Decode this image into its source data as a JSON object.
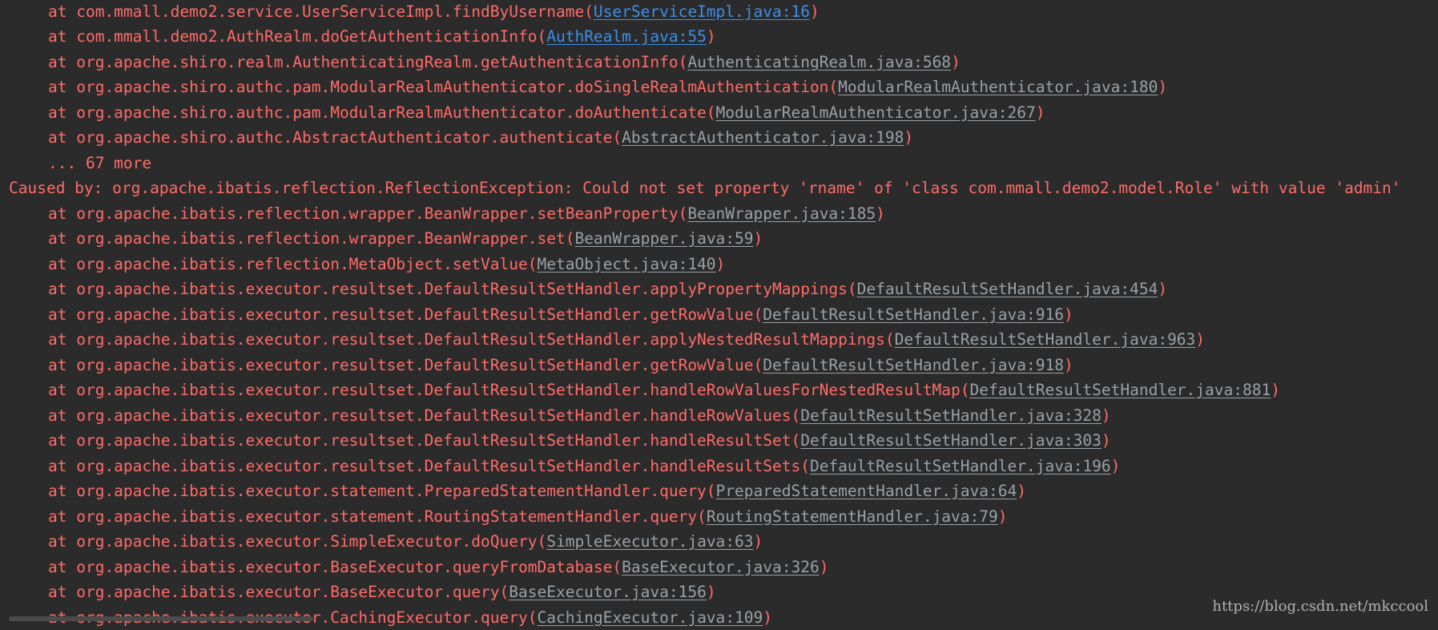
{
  "console": {
    "colors": {
      "background": "#2b2b2b",
      "error_text": "#ff6b68",
      "link_gray": "#9aa0a6",
      "link_blue": "#3d8ee8"
    },
    "lines": [
      {
        "kind": "frame",
        "prefix": "at com.mmall.demo2.service.UserServiceImpl.findByUsername(",
        "link": "UserServiceImpl.java:16",
        "suffix": ")",
        "link_style": "blue"
      },
      {
        "kind": "frame",
        "prefix": "at com.mmall.demo2.AuthRealm.doGetAuthenticationInfo(",
        "link": "AuthRealm.java:55",
        "suffix": ")",
        "link_style": "blue"
      },
      {
        "kind": "frame",
        "prefix": "at org.apache.shiro.realm.AuthenticatingRealm.getAuthenticationInfo(",
        "link": "AuthenticatingRealm.java:568",
        "suffix": ")",
        "link_style": "gray"
      },
      {
        "kind": "frame",
        "prefix": "at org.apache.shiro.authc.pam.ModularRealmAuthenticator.doSingleRealmAuthentication(",
        "link": "ModularRealmAuthenticator.java:180",
        "suffix": ")",
        "link_style": "gray"
      },
      {
        "kind": "frame",
        "prefix": "at org.apache.shiro.authc.pam.ModularRealmAuthenticator.doAuthenticate(",
        "link": "ModularRealmAuthenticator.java:267",
        "suffix": ")",
        "link_style": "gray"
      },
      {
        "kind": "frame",
        "prefix": "at org.apache.shiro.authc.AbstractAuthenticator.authenticate(",
        "link": "AbstractAuthenticator.java:198",
        "suffix": ")",
        "link_style": "gray"
      },
      {
        "kind": "more",
        "prefix": "... 67 more",
        "link": "",
        "suffix": "",
        "link_style": "none"
      },
      {
        "kind": "caused",
        "prefix": "Caused by: org.apache.ibatis.reflection.ReflectionException: Could not set property 'rname' of 'class com.mmall.demo2.model.Role' with value 'admin'",
        "link": "",
        "suffix": "",
        "link_style": "none"
      },
      {
        "kind": "frame",
        "prefix": "at org.apache.ibatis.reflection.wrapper.BeanWrapper.setBeanProperty(",
        "link": "BeanWrapper.java:185",
        "suffix": ")",
        "link_style": "gray"
      },
      {
        "kind": "frame",
        "prefix": "at org.apache.ibatis.reflection.wrapper.BeanWrapper.set(",
        "link": "BeanWrapper.java:59",
        "suffix": ")",
        "link_style": "gray"
      },
      {
        "kind": "frame",
        "prefix": "at org.apache.ibatis.reflection.MetaObject.setValue(",
        "link": "MetaObject.java:140",
        "suffix": ")",
        "link_style": "gray"
      },
      {
        "kind": "frame",
        "prefix": "at org.apache.ibatis.executor.resultset.DefaultResultSetHandler.applyPropertyMappings(",
        "link": "DefaultResultSetHandler.java:454",
        "suffix": ")",
        "link_style": "gray"
      },
      {
        "kind": "frame",
        "prefix": "at org.apache.ibatis.executor.resultset.DefaultResultSetHandler.getRowValue(",
        "link": "DefaultResultSetHandler.java:916",
        "suffix": ")",
        "link_style": "gray"
      },
      {
        "kind": "frame",
        "prefix": "at org.apache.ibatis.executor.resultset.DefaultResultSetHandler.applyNestedResultMappings(",
        "link": "DefaultResultSetHandler.java:963",
        "suffix": ")",
        "link_style": "gray"
      },
      {
        "kind": "frame",
        "prefix": "at org.apache.ibatis.executor.resultset.DefaultResultSetHandler.getRowValue(",
        "link": "DefaultResultSetHandler.java:918",
        "suffix": ")",
        "link_style": "gray"
      },
      {
        "kind": "frame",
        "prefix": "at org.apache.ibatis.executor.resultset.DefaultResultSetHandler.handleRowValuesForNestedResultMap(",
        "link": "DefaultResultSetHandler.java:881",
        "suffix": ")",
        "link_style": "gray"
      },
      {
        "kind": "frame",
        "prefix": "at org.apache.ibatis.executor.resultset.DefaultResultSetHandler.handleRowValues(",
        "link": "DefaultResultSetHandler.java:328",
        "suffix": ")",
        "link_style": "gray"
      },
      {
        "kind": "frame",
        "prefix": "at org.apache.ibatis.executor.resultset.DefaultResultSetHandler.handleResultSet(",
        "link": "DefaultResultSetHandler.java:303",
        "suffix": ")",
        "link_style": "gray"
      },
      {
        "kind": "frame",
        "prefix": "at org.apache.ibatis.executor.resultset.DefaultResultSetHandler.handleResultSets(",
        "link": "DefaultResultSetHandler.java:196",
        "suffix": ")",
        "link_style": "gray"
      },
      {
        "kind": "frame",
        "prefix": "at org.apache.ibatis.executor.statement.PreparedStatementHandler.query(",
        "link": "PreparedStatementHandler.java:64",
        "suffix": ")",
        "link_style": "gray"
      },
      {
        "kind": "frame",
        "prefix": "at org.apache.ibatis.executor.statement.RoutingStatementHandler.query(",
        "link": "RoutingStatementHandler.java:79",
        "suffix": ")",
        "link_style": "gray"
      },
      {
        "kind": "frame",
        "prefix": "at org.apache.ibatis.executor.SimpleExecutor.doQuery(",
        "link": "SimpleExecutor.java:63",
        "suffix": ")",
        "link_style": "gray"
      },
      {
        "kind": "frame",
        "prefix": "at org.apache.ibatis.executor.BaseExecutor.queryFromDatabase(",
        "link": "BaseExecutor.java:326",
        "suffix": ")",
        "link_style": "gray"
      },
      {
        "kind": "frame",
        "prefix": "at org.apache.ibatis.executor.BaseExecutor.query(",
        "link": "BaseExecutor.java:156",
        "suffix": ")",
        "link_style": "gray"
      },
      {
        "kind": "frame",
        "prefix": "at org.apache.ibatis.executor.CachingExecutor.query(",
        "link": "CachingExecutor.java:109",
        "suffix": ")",
        "link_style": "gray"
      }
    ]
  },
  "watermark": {
    "text": "https://blog.csdn.net/mkccool"
  }
}
